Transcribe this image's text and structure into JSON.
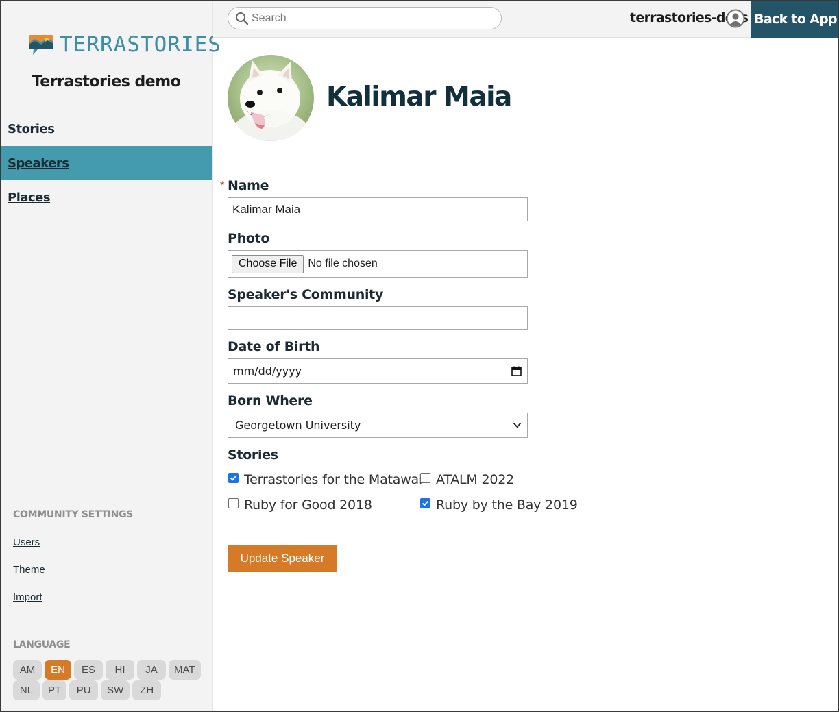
{
  "sidebar": {
    "logo_text": "TERRASTORIES",
    "community_name": "Terrastories demo",
    "nav": [
      {
        "label": "Stories",
        "active": false
      },
      {
        "label": "Speakers",
        "active": true
      },
      {
        "label": "Places",
        "active": false
      }
    ],
    "community_settings": {
      "heading": "COMMUNITY SETTINGS",
      "links": [
        "Users",
        "Theme",
        "Import"
      ]
    },
    "language": {
      "heading": "LANGUAGE",
      "row1": [
        "AM",
        "EN",
        "ES",
        "HI",
        "JA",
        "MAT"
      ],
      "row2": [
        "NL",
        "PT",
        "PU",
        "SW",
        "ZH"
      ],
      "active": "EN"
    }
  },
  "topbar": {
    "search_placeholder": "Search",
    "user_name": "terrastories-docs",
    "back_button": "Back to App"
  },
  "speaker": {
    "title": "Kalimar Maia"
  },
  "form": {
    "name_label": "Name",
    "required_mark": "*",
    "name_value": "Kalimar Maia",
    "photo_label": "Photo",
    "file_button": "Choose File",
    "file_status": "No file chosen",
    "community_label": "Speaker's Community",
    "community_value": "",
    "dob_label": "Date of Birth",
    "dob_placeholder": "mm/dd/yyyy",
    "born_where_label": "Born Where",
    "born_where_value": "Georgetown University",
    "stories_label": "Stories",
    "stories": [
      {
        "label": "Terrastories for the Matawai",
        "checked": true
      },
      {
        "label": "ATALM 2022",
        "checked": false
      },
      {
        "label": "Ruby for Good 2018",
        "checked": false
      },
      {
        "label": "Ruby by the Bay 2019",
        "checked": true
      }
    ],
    "submit": "Update Speaker"
  },
  "colors": {
    "accent_teal": "#449bad",
    "dark_navy": "#235468",
    "orange": "#d57a27"
  }
}
